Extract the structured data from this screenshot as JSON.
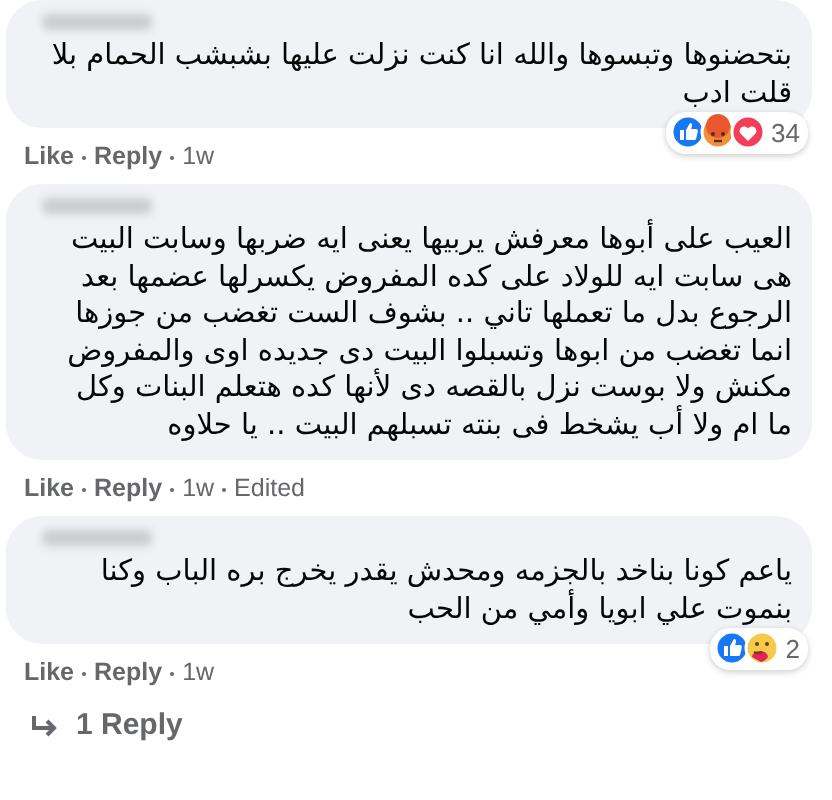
{
  "comments": [
    {
      "lines": [
        "بتحضنوها وتبسوها والله انا كنت نزلت عليها بشبشب الحمام بلا",
        "قلت ادب"
      ],
      "actions": {
        "like": "Like",
        "reply": "Reply",
        "time": "1w"
      },
      "reactions": [
        {
          "kind": "like"
        },
        {
          "kind": "angry"
        },
        {
          "kind": "love"
        }
      ],
      "reaction_count": "34"
    },
    {
      "lines": [
        "العيب على أبوها معرفش يربيها يعنى ايه ضربها وسابت البيت",
        "هى سابت ايه للولاد على كده المفروض يكسرلها عضمها بعد",
        "الرجوع بدل ما تعملها تاني .. بشوف الست تغضب من جوزها",
        "انما تغضب من ابوها وتسبلوا البيت دى جديده اوى والمفروض",
        "مكنش ولا بوست نزل بالقصه دى لأنها كده هتعلم البنات وكل",
        "ما ام ولا أب يشخط فى بنته تسبلهم البيت .. يا حلاوه"
      ],
      "actions": {
        "like": "Like",
        "reply": "Reply",
        "time": "1w",
        "edited": "Edited"
      }
    },
    {
      "lines": [
        "ياعم كونا بناخد بالجزمه ومحدش يقدر يخرج بره الباب وكنا",
        "بنموت علي ابويا وأمي من الحب"
      ],
      "actions": {
        "like": "Like",
        "reply": "Reply",
        "time": "1w"
      },
      "reactions": [
        {
          "kind": "like"
        },
        {
          "kind": "care"
        }
      ],
      "reaction_count": "2"
    }
  ],
  "replies_link": "1 Reply"
}
